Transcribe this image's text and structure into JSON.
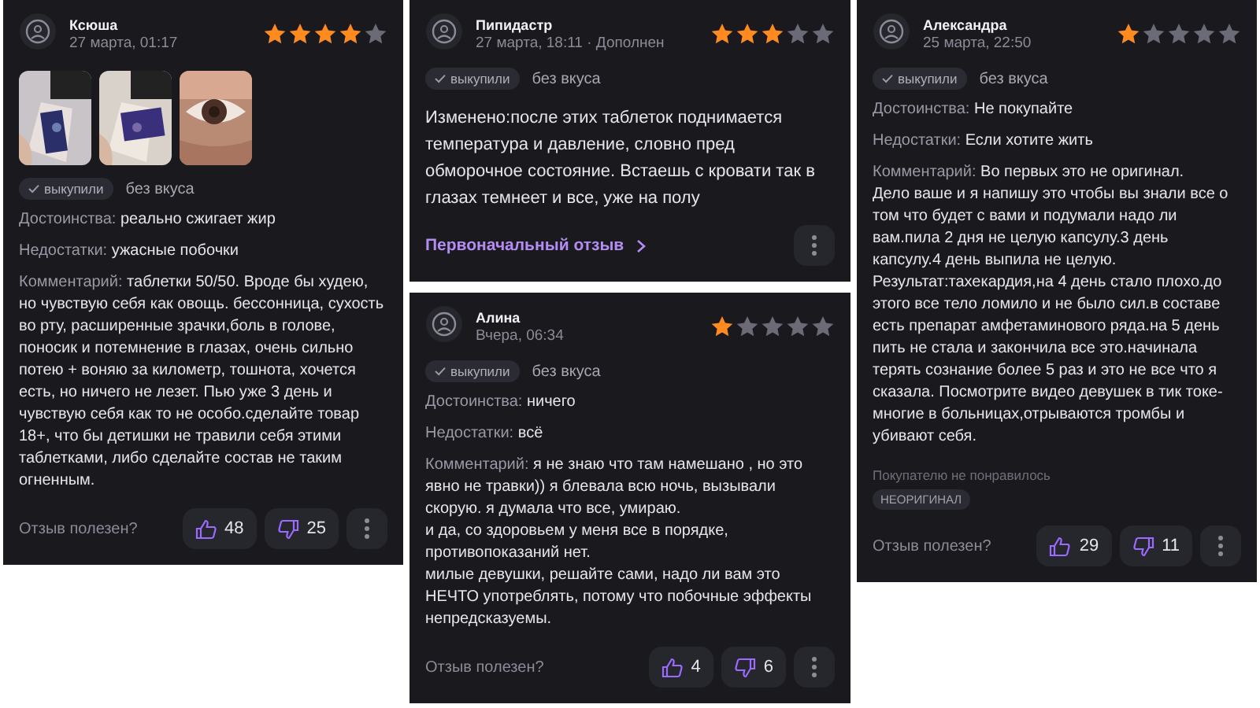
{
  "columns": [
    {
      "reviews": [
        {
          "author": "Ксюша",
          "date": "27 марта, 01:17",
          "stars": 4,
          "photos": [
            {
              "kind": "picture"
            },
            {
              "kind": "picture"
            },
            {
              "kind": "picture"
            }
          ],
          "badge": "выкупили",
          "flavor": "без вкуса",
          "sections": [
            {
              "label": "Достоинства:",
              "text": "реально сжигает жир"
            },
            {
              "label": "Недостатки:",
              "text": "ужасные побочки"
            },
            {
              "label": "Комментарий:",
              "text": "таблетки 50/50. Вроде бы худею, но чувствую себя как овощь. бессонница, сухость во рту, расширенные зрачки,боль в голове, поносик и потемнение в глазах, очень сильно потею + воняю за километр, тошнота, хочется есть, но ничего не лезет. Пью уже 3 день и чувствую себя как то не особо.сделайте товар 18+, что бы детишки не травили себя этими таблетками, либо сделайте состав не таким огненным."
            }
          ],
          "footer": {
            "question": "Отзыв полезен?",
            "likes": "48",
            "dislikes": "25"
          }
        }
      ]
    },
    {
      "reviews": [
        {
          "author": "Пипидастр",
          "date": "27 марта, 18:11 · Дополнен",
          "stars": 3,
          "badge": "выкупили",
          "flavor": "без вкуса",
          "body": "Изменено:после этих таблеток поднимается температура и давление, словно пред обморочное состояние. Встаешь с кровати так в глазах темнеет и все, уже на полу",
          "link": "Первоначальный отзыв"
        },
        {
          "author": "Алина",
          "date": "Вчера, 06:34",
          "stars": 1,
          "badge": "выкупили",
          "flavor": "без вкуса",
          "sections": [
            {
              "label": "Достоинства:",
              "text": "ничего"
            },
            {
              "label": "Недостатки:",
              "text": "всё"
            },
            {
              "label": "Комментарий:",
              "text": "я не знаю что там намешано , но это явно не травки)) я блевала всю ночь, вызывали скорую. я думала что все, умираю.\nи да, со здоровьем у меня все в порядке, противопоказаний нет.\nмилые девушки, решайте сами, надо ли вам это НЕЧТО употреблять, потому что побочные эффекты непредсказуемы."
            }
          ],
          "footer": {
            "question": "Отзыв полезен?",
            "likes": "4",
            "dislikes": "6"
          }
        }
      ]
    },
    {
      "reviews": [
        {
          "author": "Александра",
          "date": "25 марта, 22:50",
          "stars": 1,
          "badge": "выкупили",
          "flavor": "без вкуса",
          "sections": [
            {
              "label": "Достоинства:",
              "text": "Не покупайте"
            },
            {
              "label": "Недостатки:",
              "text": "Если хотите жить"
            },
            {
              "label": "Комментарий:",
              "text": "Во первых это не оригинал.\nДело ваше и я напишу это чтобы вы знали все о том что будет с вами и подумали надо ли вам.пила 2 дня не целую капсулу.3 день капсулу.4 день выпила не целую.\nРезультат:тахекардия,на 4 день стало плохо.до этого все тело ломило и не было сил.в составе есть препарат амфетаминового ряда.на 5 день пить не стала и закончила все это.начинала терять сознание более 5 раз и это не все что я сказала. Посмотрите видео девушек в тик токе-многие в больницах,отрываются тромбы и убивают себя."
            }
          ],
          "dislike_note": "Покупателю не понравилось",
          "dislike_tags": [
            "НЕОРИГИНАЛ"
          ],
          "footer": {
            "question": "Отзыв полезен?",
            "likes": "29",
            "dislikes": "11"
          }
        }
      ]
    }
  ]
}
